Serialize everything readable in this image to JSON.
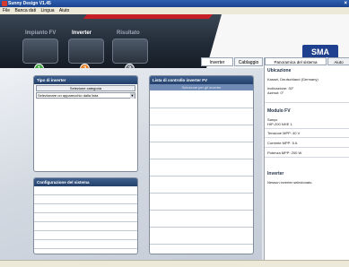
{
  "window": {
    "title": "Sunny Design V1.45",
    "close": "×"
  },
  "menu": {
    "items": [
      "File",
      "Banca dati",
      "Lingua",
      "Aiuto"
    ]
  },
  "banner": {
    "tabs": [
      {
        "label": "Impianto FV",
        "step": "1",
        "color": "#3aa83a"
      },
      {
        "label": "Inverter",
        "step": "2",
        "color": "#e87c1c"
      },
      {
        "label": "Risultato",
        "step": "3",
        "color": "#6c727c"
      }
    ],
    "logo": "SMA"
  },
  "subtabs": {
    "inverter": "Inverter",
    "cablaggio": "Cablaggio"
  },
  "tipo_inverter": {
    "title": "Tipo di inverter",
    "button": "Selezione categoria",
    "select_value": "Selezionare un apparecchio dalla lista"
  },
  "lista": {
    "title": "Lista di controllo inverter FV",
    "header": "Selezione per gli inverter"
  },
  "configurazione": {
    "title": "Configurazione del sistema"
  },
  "panoramica": {
    "tabs": [
      "Panoramica del sistema",
      "Aiuto"
    ],
    "ubicazione": {
      "title": "Ubicazione",
      "lines": [
        "Kassel, Deutschland (Germany)",
        "Inclinazione: 30°",
        "Azimut: 0°"
      ]
    },
    "modulo": {
      "title": "Modulo FV",
      "lines": [
        "Sanyo",
        "HIP-200 NHE 1",
        "Tensione MPP: 40 V",
        "Corrente MPP: 5 A",
        "Potenza MPP: 200 W"
      ]
    },
    "inverter": {
      "title": "Inverter",
      "lines": [
        "Nessun inverter selezionato."
      ]
    }
  }
}
